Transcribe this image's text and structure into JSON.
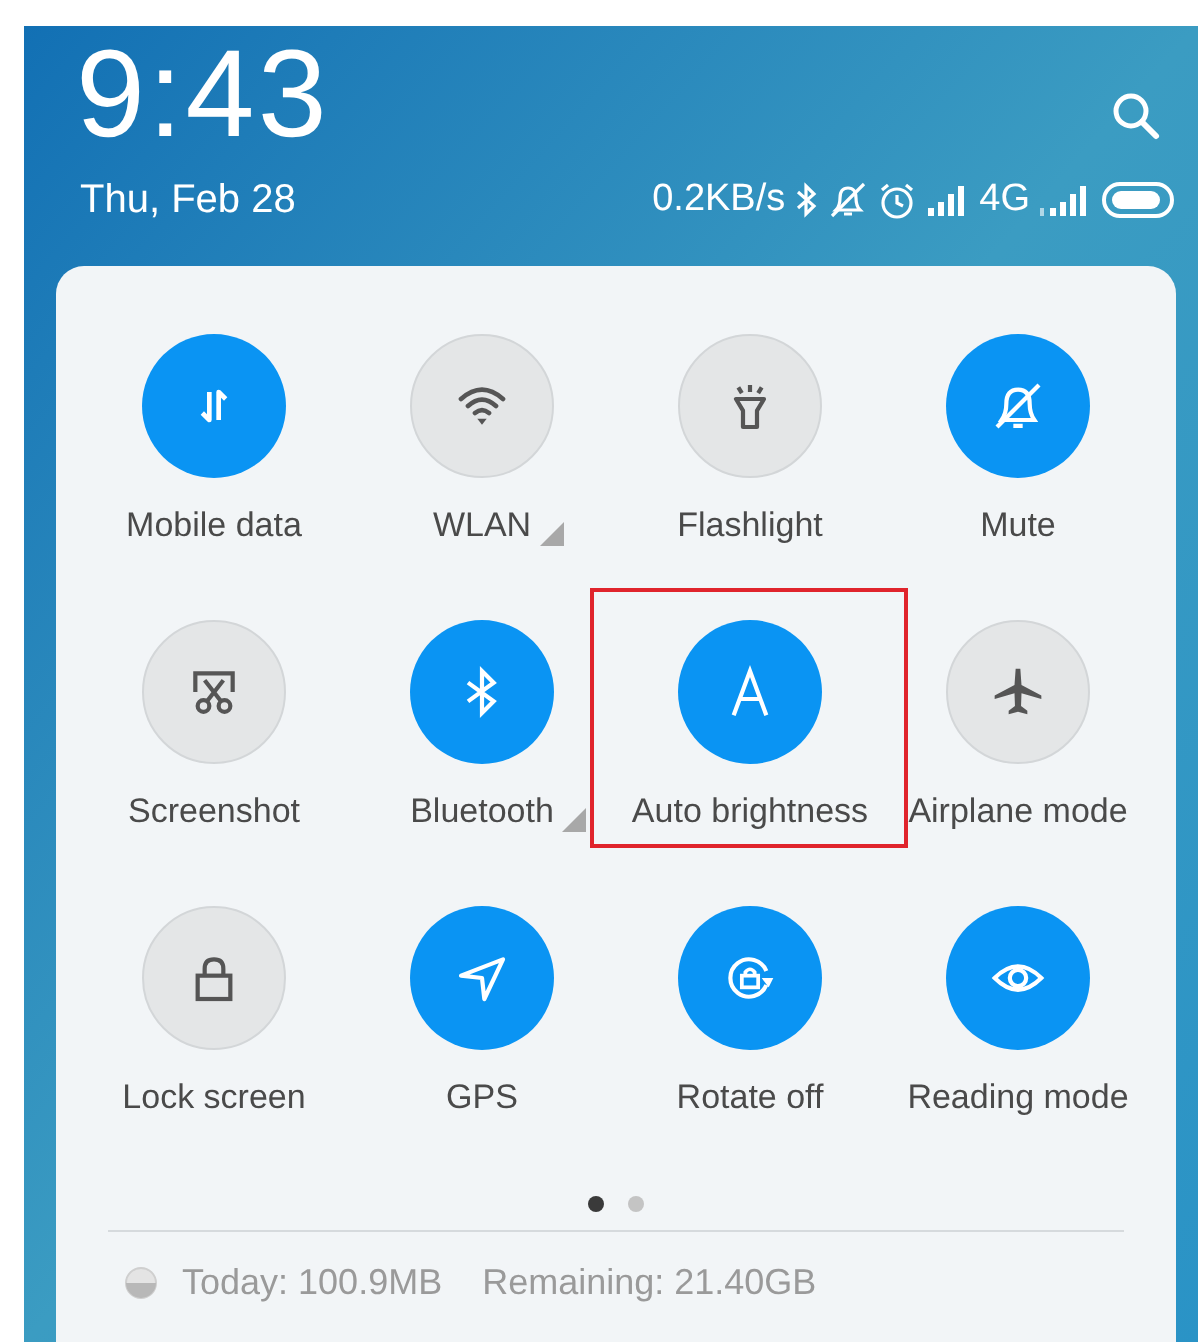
{
  "header": {
    "time": "9:43",
    "date": "Thu, Feb 28",
    "net_speed": "0.2KB/s",
    "network_type": "4G"
  },
  "tiles": [
    {
      "label": "Mobile data",
      "on": true,
      "has_more": false,
      "highlighted": false
    },
    {
      "label": "WLAN",
      "on": false,
      "has_more": true,
      "highlighted": false
    },
    {
      "label": "Flashlight",
      "on": false,
      "has_more": false,
      "highlighted": false
    },
    {
      "label": "Mute",
      "on": true,
      "has_more": false,
      "highlighted": false
    },
    {
      "label": "Screenshot",
      "on": false,
      "has_more": false,
      "highlighted": false
    },
    {
      "label": "Bluetooth",
      "on": true,
      "has_more": true,
      "highlighted": false
    },
    {
      "label": "Auto brightness",
      "on": true,
      "has_more": false,
      "highlighted": true
    },
    {
      "label": "Airplane mode",
      "on": false,
      "has_more": false,
      "highlighted": false
    },
    {
      "label": "Lock screen",
      "on": false,
      "has_more": false,
      "highlighted": false
    },
    {
      "label": "GPS",
      "on": true,
      "has_more": false,
      "highlighted": false
    },
    {
      "label": "Rotate off",
      "on": true,
      "has_more": false,
      "highlighted": false
    },
    {
      "label": "Reading mode",
      "on": true,
      "has_more": false,
      "highlighted": false
    }
  ],
  "pages": [
    {
      "selected": true
    },
    {
      "selected": false
    }
  ],
  "footer": {
    "today": "Today: 100.9MB",
    "remaining": "Remaining: 21.40GB"
  }
}
